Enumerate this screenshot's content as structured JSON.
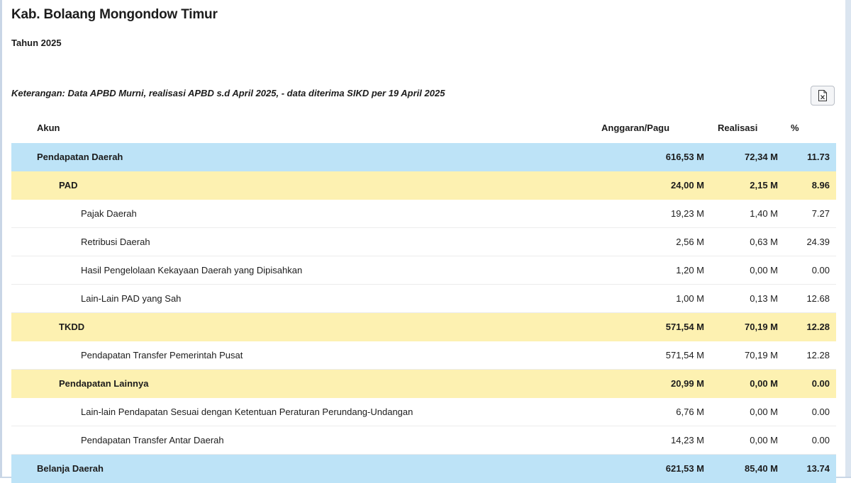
{
  "header": {
    "title": "Kab. Bolaang Mongondow Timur",
    "year": "Tahun 2025",
    "note": "Keterangan: Data APBD Murni, realisasi APBD s.d April 2025, - data diterima SIKD per 19 April 2025",
    "export_icon": "excel-file-icon"
  },
  "table": {
    "columns": {
      "akun": "Akun",
      "pagu": "Anggaran/Pagu",
      "realisasi": "Realisasi",
      "persen": "%"
    },
    "rows": [
      {
        "name": "Pendapatan Daerah",
        "pagu": "616,53 M",
        "realisasi": "72,34 M",
        "persen": "11.73",
        "level": 0
      },
      {
        "name": "PAD",
        "pagu": "24,00 M",
        "realisasi": "2,15 M",
        "persen": "8.96",
        "level": 1
      },
      {
        "name": "Pajak Daerah",
        "pagu": "19,23 M",
        "realisasi": "1,40 M",
        "persen": "7.27",
        "level": 2
      },
      {
        "name": "Retribusi Daerah",
        "pagu": "2,56 M",
        "realisasi": "0,63 M",
        "persen": "24.39",
        "level": 2
      },
      {
        "name": "Hasil Pengelolaan Kekayaan Daerah yang Dipisahkan",
        "pagu": "1,20 M",
        "realisasi": "0,00 M",
        "persen": "0.00",
        "level": 2
      },
      {
        "name": "Lain-Lain PAD yang Sah",
        "pagu": "1,00 M",
        "realisasi": "0,13 M",
        "persen": "12.68",
        "level": 2
      },
      {
        "name": "TKDD",
        "pagu": "571,54 M",
        "realisasi": "70,19 M",
        "persen": "12.28",
        "level": 1
      },
      {
        "name": "Pendapatan Transfer Pemerintah Pusat",
        "pagu": "571,54 M",
        "realisasi": "70,19 M",
        "persen": "12.28",
        "level": 2
      },
      {
        "name": "Pendapatan Lainnya",
        "pagu": "20,99 M",
        "realisasi": "0,00 M",
        "persen": "0.00",
        "level": 1
      },
      {
        "name": "Lain-lain Pendapatan Sesuai dengan Ketentuan Peraturan Perundang-Undangan",
        "pagu": "6,76 M",
        "realisasi": "0,00 M",
        "persen": "0.00",
        "level": 2
      },
      {
        "name": "Pendapatan Transfer Antar Daerah",
        "pagu": "14,23 M",
        "realisasi": "0,00 M",
        "persen": "0.00",
        "level": 2
      },
      {
        "name": "Belanja Daerah",
        "pagu": "621,53 M",
        "realisasi": "85,40 M",
        "persen": "13.74",
        "level": 0
      }
    ]
  }
}
